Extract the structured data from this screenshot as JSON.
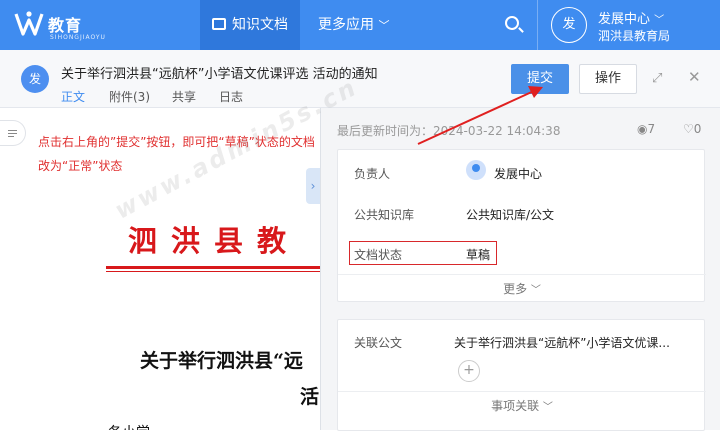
{
  "app": {
    "logo_text": "教育",
    "logo_sub": "SIHONGJIAOYU"
  },
  "nav": {
    "knowledge": "知识文档",
    "more_apps": "更多应用"
  },
  "user": {
    "avatar": "发",
    "name": "发展中心",
    "org": "泗洪县教育局"
  },
  "doc": {
    "avatar": "发",
    "title": "关于举行泗洪县“远航杯”小学语文优课评选 活动的通知",
    "tabs": [
      "正文",
      "附件(3)",
      "共享",
      "日志"
    ],
    "submit": "提交",
    "action": "操作"
  },
  "annotation": "点击右上角的”提交”按钮，即可把“草稿”状态的文档改为“正常”状态",
  "content": {
    "red_title": "泗洪县教",
    "heading1": "关于举行泗洪县“远",
    "heading2": "活",
    "para": "各小学"
  },
  "info": {
    "updated": "最后更新时间为：2024-03-22 14:04:38",
    "views": "7",
    "likes": "0",
    "owner_label": "负责人",
    "owner": "发展中心",
    "lib_label": "公共知识库",
    "lib": "公共知识库/公文",
    "status_label": "文档状态",
    "status": "草稿",
    "more": "更多"
  },
  "related": {
    "label": "关联公文",
    "value": "关于举行泗洪县“远航杯”小学语文优课...",
    "link": "事项关联"
  },
  "watermark": "www.admin5s.cn"
}
